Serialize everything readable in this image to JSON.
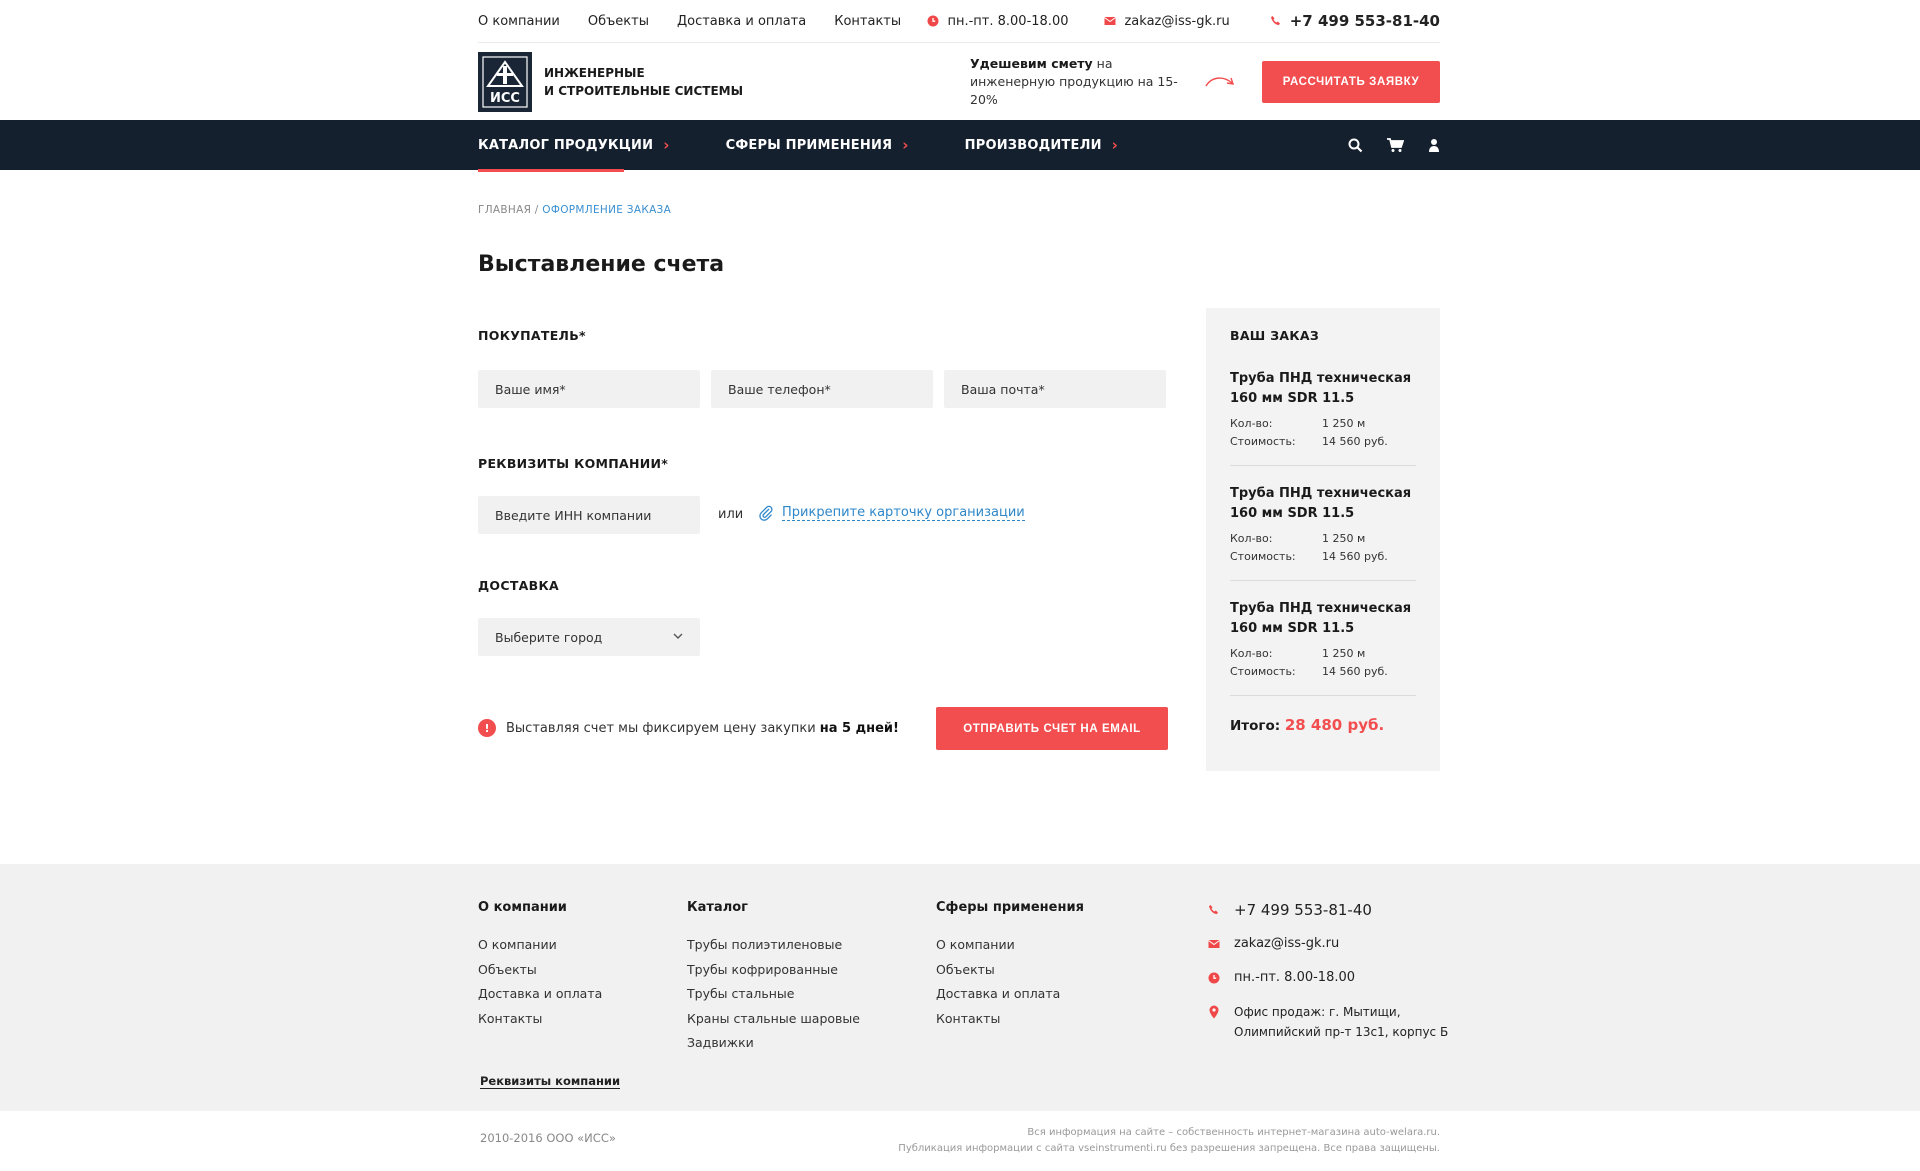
{
  "topbar": {
    "links": [
      "О компании",
      "Объекты",
      "Доставка и оплата",
      "Контакты"
    ],
    "hours": "пн.-пт. 8.00-18.00",
    "email": "zakaz@iss-gk.ru",
    "phone": "+7 499 553-81-40"
  },
  "header": {
    "logo_text": "ИСС",
    "brand_line1": "ИНЖЕНЕРНЫЕ",
    "brand_line2": "И СТРОИТЕЛЬНЫЕ СИСТЕМЫ",
    "promo_bold": "Удешевим смету",
    "promo_rest": " на инженерную продукцию на 15-20%",
    "cta": "РАССЧИТАТЬ ЗАЯВКУ"
  },
  "nav": {
    "items": [
      "КАТАЛОГ ПРОДУКЦИИ",
      "СФЕРЫ ПРИМЕНЕНИЯ",
      "ПРОИЗВОДИТЕЛИ"
    ]
  },
  "breadcrumb": {
    "home": "ГЛАВНАЯ",
    "sep": " / ",
    "current": "ОФОРМЛЕНИЕ ЗАКАЗА"
  },
  "page_title": "Выставление счета",
  "form": {
    "buyer_title": "ПОКУПАТЕЛЬ*",
    "name_placeholder": "Ваше имя*",
    "phone_placeholder": "Ваше телефон*",
    "email_placeholder": "Ваша почта*",
    "company_title": "РЕКВИЗИТЫ КОМПАНИИ*",
    "inn_placeholder": "Введите ИНН компании",
    "or": "или",
    "attach_label": "Прикрепите карточку организации",
    "delivery_title": "ДОСТАВКА",
    "city_select": "Выберите город",
    "notice_text": "Выставляя счет мы фиксируем цену закупки",
    "notice_bold": "на 5 дней!",
    "submit": "ОТПРАВИТЬ СЧЕТ НА EMAIL"
  },
  "order": {
    "title": "ВАШ ЗАКАЗ",
    "qty_label": "Кол-во:",
    "cost_label": "Стоимость:",
    "items": [
      {
        "name": "Труба ПНД техническая 160 мм SDR 11.5",
        "qty": "1 250 м",
        "cost": "14 560 руб."
      },
      {
        "name": "Труба ПНД техническая 160 мм SDR 11.5",
        "qty": "1 250 м",
        "cost": "14 560 руб."
      },
      {
        "name": "Труба ПНД техническая 160 мм SDR 11.5",
        "qty": "1 250 м",
        "cost": "14 560 руб."
      }
    ],
    "total_label": "Итого:",
    "total_value": "28 480 руб."
  },
  "footer": {
    "col1": {
      "title": "О компании",
      "links": [
        "О компании",
        "Объекты",
        "Доставка и оплата",
        "Контакты"
      ]
    },
    "col2": {
      "title": "Каталог",
      "links": [
        "Трубы полиэтиленовые",
        "Трубы кофрированные",
        "Трубы стальные",
        "Краны стальные шаровые",
        "Задвижки"
      ]
    },
    "col3": {
      "title": "Сферы применения",
      "links": [
        "О компании",
        "Объекты",
        "Доставка и оплата",
        "Контакты"
      ]
    },
    "phone": "+7 499 553-81-40",
    "email": "zakaz@iss-gk.ru",
    "hours": "пн.-пт. 8.00-18.00",
    "office_line1": "Офис продаж: г. Мытищи,",
    "office_line2": "Олимпийский пр-т 13с1, корпус Б",
    "requisites": "Реквизиты компании"
  },
  "bottom": {
    "copyright": "2010-2016 ООО «ИСС»",
    "rights_line1": "Вся информация на сайте – собственность интернет-магазина auto-welara.ru.",
    "rights_line2": "Публикация информации с сайта vseinstrumenti.ru без разрешения запрещена. Все права защищены."
  },
  "colors": {
    "accent": "#f24e4f",
    "nav_bg": "#14202e",
    "link": "#2e87c9"
  }
}
